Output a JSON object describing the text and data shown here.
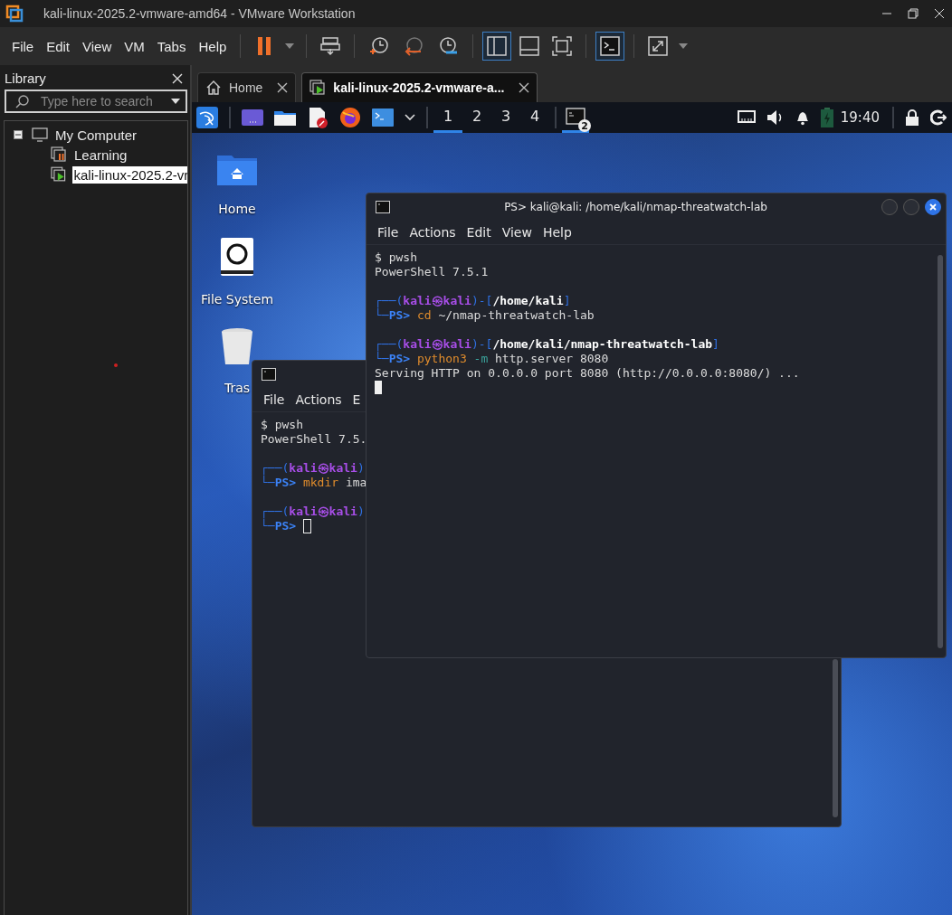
{
  "window": {
    "title": "kali-linux-2025.2-vmware-amd64 - VMware Workstation"
  },
  "menu": [
    "File",
    "Edit",
    "View",
    "VM",
    "Tabs",
    "Help"
  ],
  "toolbar": {
    "view_modes": [
      {
        "kind": "library",
        "selected": true
      },
      {
        "kind": "thumbnail",
        "selected": false
      },
      {
        "kind": "fit",
        "selected": false
      }
    ],
    "console": {
      "selected": true
    }
  },
  "library": {
    "title": "Library",
    "search": {
      "placeholder": "Type here to search"
    },
    "tree": [
      {
        "label": "My Computer",
        "expanded": true,
        "selected": false,
        "children": [
          {
            "label": "Learning",
            "kind": "paused",
            "selected": false
          },
          {
            "label": "kali-linux-2025.2-vr",
            "kind": "running",
            "selected": true
          }
        ]
      }
    ]
  },
  "tabs": [
    {
      "label": "Home",
      "kind": "home",
      "selected": false
    },
    {
      "label": "kali-linux-2025.2-vmware-a...",
      "kind": "vm",
      "selected": true
    }
  ],
  "guest": {
    "panel": {
      "workspaces": [
        {
          "label": "1",
          "selected": true
        },
        {
          "label": "2",
          "selected": false
        },
        {
          "label": "3",
          "selected": false
        },
        {
          "label": "4",
          "selected": false
        }
      ],
      "task_badge": "2",
      "clock": "19:40"
    },
    "desktop_icons": [
      {
        "label": "Home",
        "kind": "home"
      },
      {
        "label": "File System",
        "kind": "drive"
      },
      {
        "label": "Tras",
        "kind": "trash"
      }
    ],
    "terminals": [
      {
        "menu": [
          "File",
          "Actions",
          "E"
        ],
        "lines": [
          {
            "kind": "output",
            "text": "$ pwsh"
          },
          {
            "kind": "output",
            "text": "PowerShell 7.5."
          },
          {
            "kind": "blank"
          },
          {
            "kind": "prompt",
            "open": "┌──(",
            "user": "kali㉿kali",
            "mid": ")",
            "lead": "└─",
            "ps": "PS>",
            "parts": [
              {
                "kind": "command",
                "text": "mkdir"
              },
              {
                "kind": "arg",
                "text": "ima"
              }
            ]
          },
          {
            "kind": "blank"
          },
          {
            "kind": "prompt",
            "open": "┌──(",
            "user": "kali㉿kali",
            "mid": ")",
            "lead": "└─",
            "ps": "PS>",
            "cursor": true
          }
        ]
      },
      {
        "title": "PS> kali@kali: /home/kali/nmap-threatwatch-lab",
        "menu": [
          "File",
          "Actions",
          "Edit",
          "View",
          "Help"
        ],
        "lines": [
          {
            "kind": "output",
            "text": "$ pwsh"
          },
          {
            "kind": "output",
            "text": "PowerShell 7.5.1"
          },
          {
            "kind": "blank"
          },
          {
            "kind": "prompt",
            "open": "┌──(",
            "user": "kali㉿kali",
            "mid": ")-[",
            "path": "/home/kali",
            "close": "]",
            "lead": "└─",
            "ps": "PS>",
            "parts": [
              {
                "kind": "command",
                "text": "cd"
              },
              {
                "kind": "arg",
                "text": "~/nmap-threatwatch-lab"
              }
            ]
          },
          {
            "kind": "blank"
          },
          {
            "kind": "prompt",
            "open": "┌──(",
            "user": "kali㉿kali",
            "mid": ")-[",
            "path": "/home/kali/nmap-threatwatch-lab",
            "close": "]",
            "lead": "└─",
            "ps": "PS>",
            "parts": [
              {
                "kind": "command",
                "text": "python3"
              },
              {
                "kind": "flag",
                "text": "-m"
              },
              {
                "kind": "arg",
                "text": "http.server 8080"
              }
            ]
          },
          {
            "kind": "output",
            "text": "Serving HTTP on 0.0.0.0 port 8080 (http://0.0.0.0:8080/) ..."
          },
          {
            "kind": "cursor"
          }
        ]
      }
    ]
  }
}
